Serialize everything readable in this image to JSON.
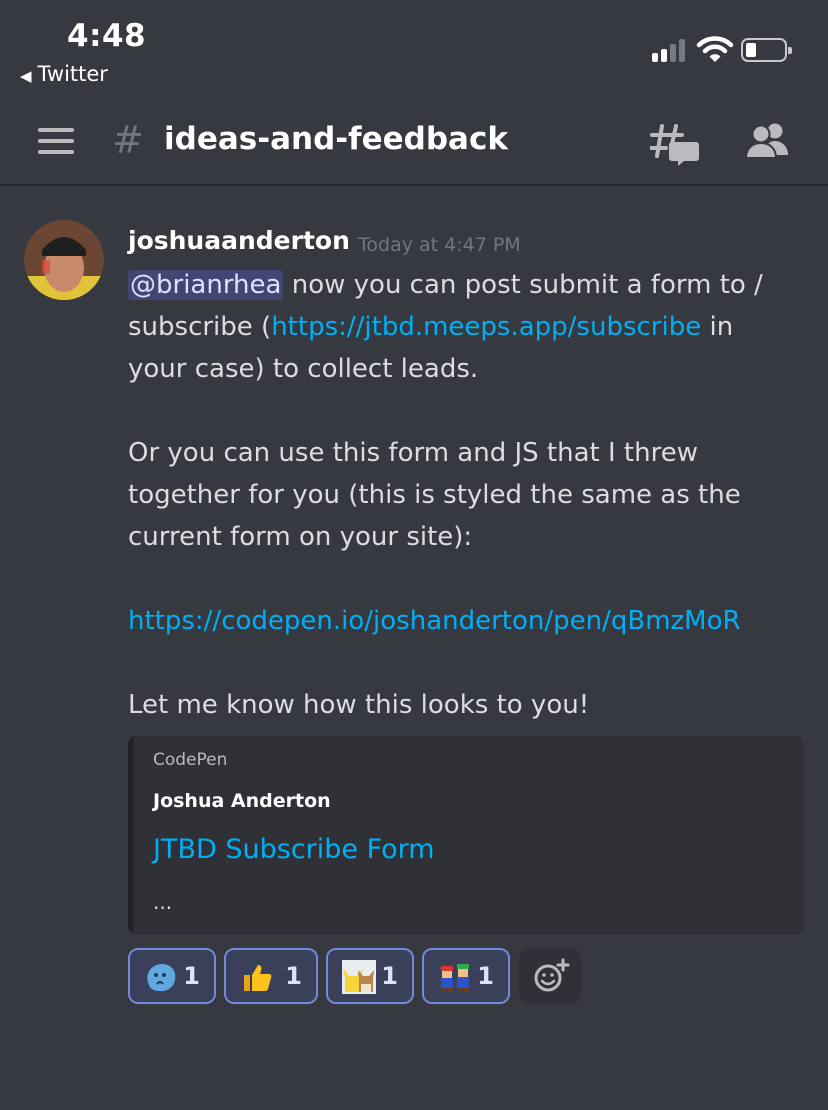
{
  "status_bar": {
    "time": "4:48",
    "back_app": "Twitter"
  },
  "header": {
    "channel_hash": "#",
    "channel_name": "ideas-and-feedback"
  },
  "message": {
    "author": "joshuaanderton",
    "timestamp": "Today at 4:47 PM",
    "mention": "@brianrhea",
    "line1_rest": " now you can post submit a form to /",
    "line2_pre": "subscribe (",
    "line2_link": "https://jtbd.meeps.app/subscribe",
    "line2_post": " in",
    "line3": "your case) to collect leads.",
    "para2_line1": "Or you can use this form and JS that I threw",
    "para2_line2": "together for you (this is styled the same as the",
    "para2_line3": "current form on your site):",
    "link2": "https://codepen.io/joshanderton/pen/qBmzMoR",
    "para3": "Let me know how this looks to you!"
  },
  "embed": {
    "provider": "CodePen",
    "author": "Joshua Anderton",
    "title": "JTBD Subscribe Form",
    "description": "..."
  },
  "reactions": [
    {
      "icon": "blue-blob-emoji",
      "count": "1"
    },
    {
      "icon": "thumbs-up-emoji",
      "count": "1"
    },
    {
      "icon": "pikachu-eevee-emoji",
      "count": "1"
    },
    {
      "icon": "mario-luigi-emoji",
      "count": "1"
    }
  ],
  "colors": {
    "background": "#36393f",
    "link": "#00aff4",
    "mention_bg": "#414675",
    "reaction_border": "#7289da",
    "embed_bg": "#2f3136"
  }
}
